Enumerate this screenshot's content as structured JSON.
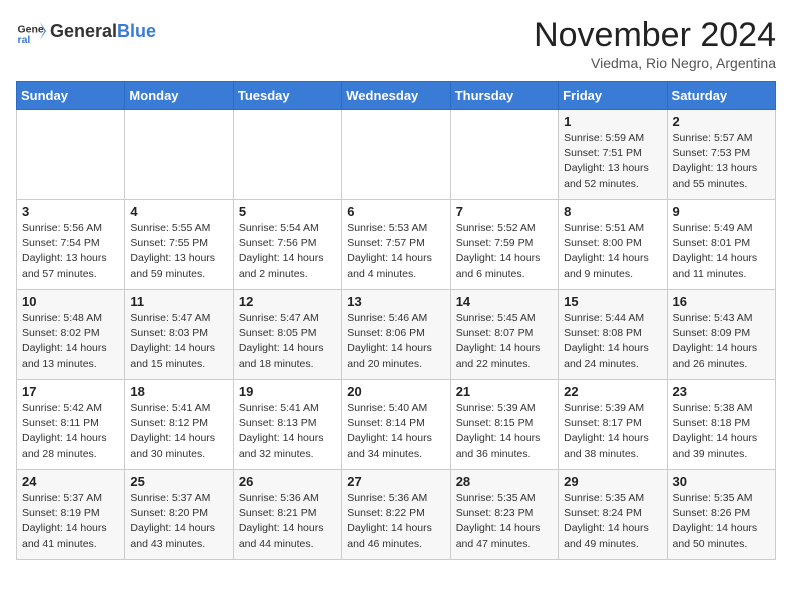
{
  "logo": {
    "general": "General",
    "blue": "Blue"
  },
  "title": "November 2024",
  "location": "Viedma, Rio Negro, Argentina",
  "headers": [
    "Sunday",
    "Monday",
    "Tuesday",
    "Wednesday",
    "Thursday",
    "Friday",
    "Saturday"
  ],
  "weeks": [
    [
      {
        "day": "",
        "info": ""
      },
      {
        "day": "",
        "info": ""
      },
      {
        "day": "",
        "info": ""
      },
      {
        "day": "",
        "info": ""
      },
      {
        "day": "",
        "info": ""
      },
      {
        "day": "1",
        "info": "Sunrise: 5:59 AM\nSunset: 7:51 PM\nDaylight: 13 hours\nand 52 minutes."
      },
      {
        "day": "2",
        "info": "Sunrise: 5:57 AM\nSunset: 7:53 PM\nDaylight: 13 hours\nand 55 minutes."
      }
    ],
    [
      {
        "day": "3",
        "info": "Sunrise: 5:56 AM\nSunset: 7:54 PM\nDaylight: 13 hours\nand 57 minutes."
      },
      {
        "day": "4",
        "info": "Sunrise: 5:55 AM\nSunset: 7:55 PM\nDaylight: 13 hours\nand 59 minutes."
      },
      {
        "day": "5",
        "info": "Sunrise: 5:54 AM\nSunset: 7:56 PM\nDaylight: 14 hours\nand 2 minutes."
      },
      {
        "day": "6",
        "info": "Sunrise: 5:53 AM\nSunset: 7:57 PM\nDaylight: 14 hours\nand 4 minutes."
      },
      {
        "day": "7",
        "info": "Sunrise: 5:52 AM\nSunset: 7:59 PM\nDaylight: 14 hours\nand 6 minutes."
      },
      {
        "day": "8",
        "info": "Sunrise: 5:51 AM\nSunset: 8:00 PM\nDaylight: 14 hours\nand 9 minutes."
      },
      {
        "day": "9",
        "info": "Sunrise: 5:49 AM\nSunset: 8:01 PM\nDaylight: 14 hours\nand 11 minutes."
      }
    ],
    [
      {
        "day": "10",
        "info": "Sunrise: 5:48 AM\nSunset: 8:02 PM\nDaylight: 14 hours\nand 13 minutes."
      },
      {
        "day": "11",
        "info": "Sunrise: 5:47 AM\nSunset: 8:03 PM\nDaylight: 14 hours\nand 15 minutes."
      },
      {
        "day": "12",
        "info": "Sunrise: 5:47 AM\nSunset: 8:05 PM\nDaylight: 14 hours\nand 18 minutes."
      },
      {
        "day": "13",
        "info": "Sunrise: 5:46 AM\nSunset: 8:06 PM\nDaylight: 14 hours\nand 20 minutes."
      },
      {
        "day": "14",
        "info": "Sunrise: 5:45 AM\nSunset: 8:07 PM\nDaylight: 14 hours\nand 22 minutes."
      },
      {
        "day": "15",
        "info": "Sunrise: 5:44 AM\nSunset: 8:08 PM\nDaylight: 14 hours\nand 24 minutes."
      },
      {
        "day": "16",
        "info": "Sunrise: 5:43 AM\nSunset: 8:09 PM\nDaylight: 14 hours\nand 26 minutes."
      }
    ],
    [
      {
        "day": "17",
        "info": "Sunrise: 5:42 AM\nSunset: 8:11 PM\nDaylight: 14 hours\nand 28 minutes."
      },
      {
        "day": "18",
        "info": "Sunrise: 5:41 AM\nSunset: 8:12 PM\nDaylight: 14 hours\nand 30 minutes."
      },
      {
        "day": "19",
        "info": "Sunrise: 5:41 AM\nSunset: 8:13 PM\nDaylight: 14 hours\nand 32 minutes."
      },
      {
        "day": "20",
        "info": "Sunrise: 5:40 AM\nSunset: 8:14 PM\nDaylight: 14 hours\nand 34 minutes."
      },
      {
        "day": "21",
        "info": "Sunrise: 5:39 AM\nSunset: 8:15 PM\nDaylight: 14 hours\nand 36 minutes."
      },
      {
        "day": "22",
        "info": "Sunrise: 5:39 AM\nSunset: 8:17 PM\nDaylight: 14 hours\nand 38 minutes."
      },
      {
        "day": "23",
        "info": "Sunrise: 5:38 AM\nSunset: 8:18 PM\nDaylight: 14 hours\nand 39 minutes."
      }
    ],
    [
      {
        "day": "24",
        "info": "Sunrise: 5:37 AM\nSunset: 8:19 PM\nDaylight: 14 hours\nand 41 minutes."
      },
      {
        "day": "25",
        "info": "Sunrise: 5:37 AM\nSunset: 8:20 PM\nDaylight: 14 hours\nand 43 minutes."
      },
      {
        "day": "26",
        "info": "Sunrise: 5:36 AM\nSunset: 8:21 PM\nDaylight: 14 hours\nand 44 minutes."
      },
      {
        "day": "27",
        "info": "Sunrise: 5:36 AM\nSunset: 8:22 PM\nDaylight: 14 hours\nand 46 minutes."
      },
      {
        "day": "28",
        "info": "Sunrise: 5:35 AM\nSunset: 8:23 PM\nDaylight: 14 hours\nand 47 minutes."
      },
      {
        "day": "29",
        "info": "Sunrise: 5:35 AM\nSunset: 8:24 PM\nDaylight: 14 hours\nand 49 minutes."
      },
      {
        "day": "30",
        "info": "Sunrise: 5:35 AM\nSunset: 8:26 PM\nDaylight: 14 hours\nand 50 minutes."
      }
    ]
  ]
}
